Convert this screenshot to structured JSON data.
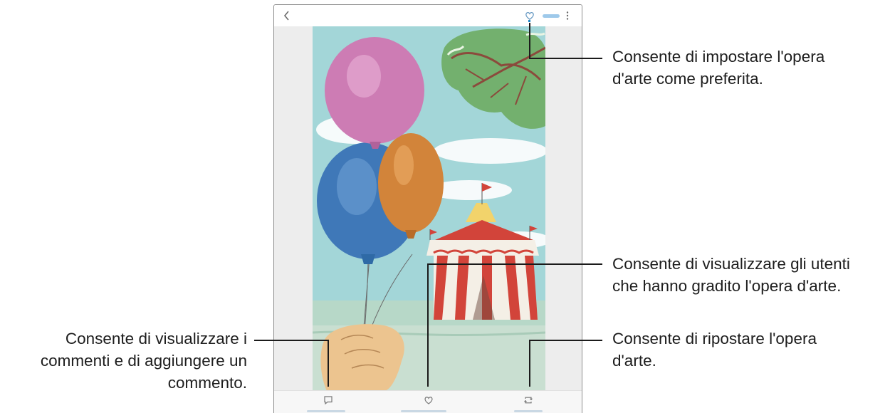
{
  "callouts": {
    "favorite": {
      "line1": "Consente di impostare l'opera",
      "line2": "d'arte come preferita."
    },
    "likes": {
      "line1": "Consente di visualizzare gli utenti",
      "line2": "che hanno gradito l'opera d'arte."
    },
    "comments": {
      "line1": "Consente di visualizzare i",
      "line2": "commenti e di aggiungere un",
      "line3": "commento."
    },
    "repost": {
      "line1": "Consente di ripostare l'opera",
      "line2": "d'arte."
    }
  },
  "icons": {
    "back": "chevron-left-icon",
    "favorite": "heart-icon",
    "more": "more-vertical-icon",
    "comment": "comment-icon",
    "likes": "heart-icon",
    "repost": "repost-icon"
  },
  "colors": {
    "accent_blue": "#9ec9ea",
    "leader_line": "#1b1b1b",
    "sky": "#9fd3d6"
  }
}
